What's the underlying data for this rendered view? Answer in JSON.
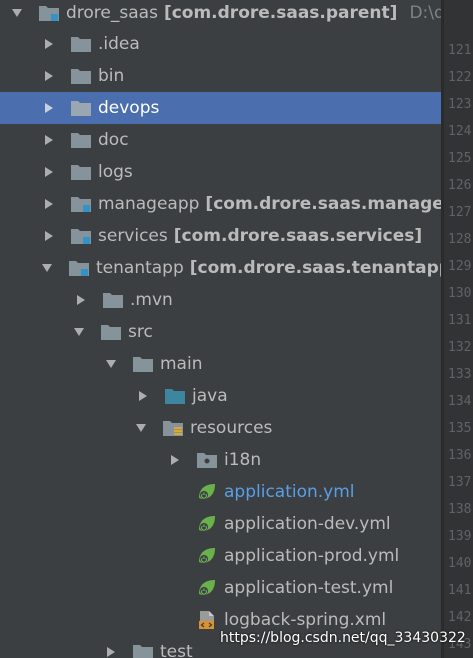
{
  "project_tree": {
    "root": {
      "name": "drore_saas",
      "module": "[com.drore.saas.parent]",
      "path": "D:\\drc"
    },
    "rows": [
      {
        "name": ".idea"
      },
      {
        "name": "bin"
      },
      {
        "name": "devops"
      },
      {
        "name": "doc"
      },
      {
        "name": "logs"
      },
      {
        "name": "manageapp",
        "module": "[com.drore.saas.manageap"
      },
      {
        "name": "services",
        "module": "[com.drore.saas.services]"
      },
      {
        "name": "tenantapp",
        "module": "[com.drore.saas.tenantapp]"
      },
      {
        "name": ".mvn"
      },
      {
        "name": "src"
      },
      {
        "name": "main"
      },
      {
        "name": "java"
      },
      {
        "name": "resources"
      },
      {
        "name": "i18n"
      },
      {
        "name": "application.yml"
      },
      {
        "name": "application-dev.yml"
      },
      {
        "name": "application-prod.yml"
      },
      {
        "name": "application-test.yml"
      },
      {
        "name": "logback-spring.xml"
      },
      {
        "name": "test"
      }
    ],
    "selected_item": "devops"
  },
  "gutter": {
    "line_numbers": [
      "121",
      "122",
      "123",
      "124",
      "125",
      "126",
      "127",
      "128",
      "129",
      "130",
      "131",
      "132",
      "133",
      "134",
      "135",
      "136",
      "137",
      "138",
      "139",
      "140",
      "141",
      "142",
      "143"
    ]
  },
  "watermark": "https://blog.csdn.net/qq_33430322",
  "colors": {
    "background": "#3c3f41",
    "selection": "#4b6eaf",
    "folder": "#87939a",
    "source_folder": "#3e86a0",
    "spring_green": "#6ab04c",
    "link_blue": "#5a9ee6"
  }
}
